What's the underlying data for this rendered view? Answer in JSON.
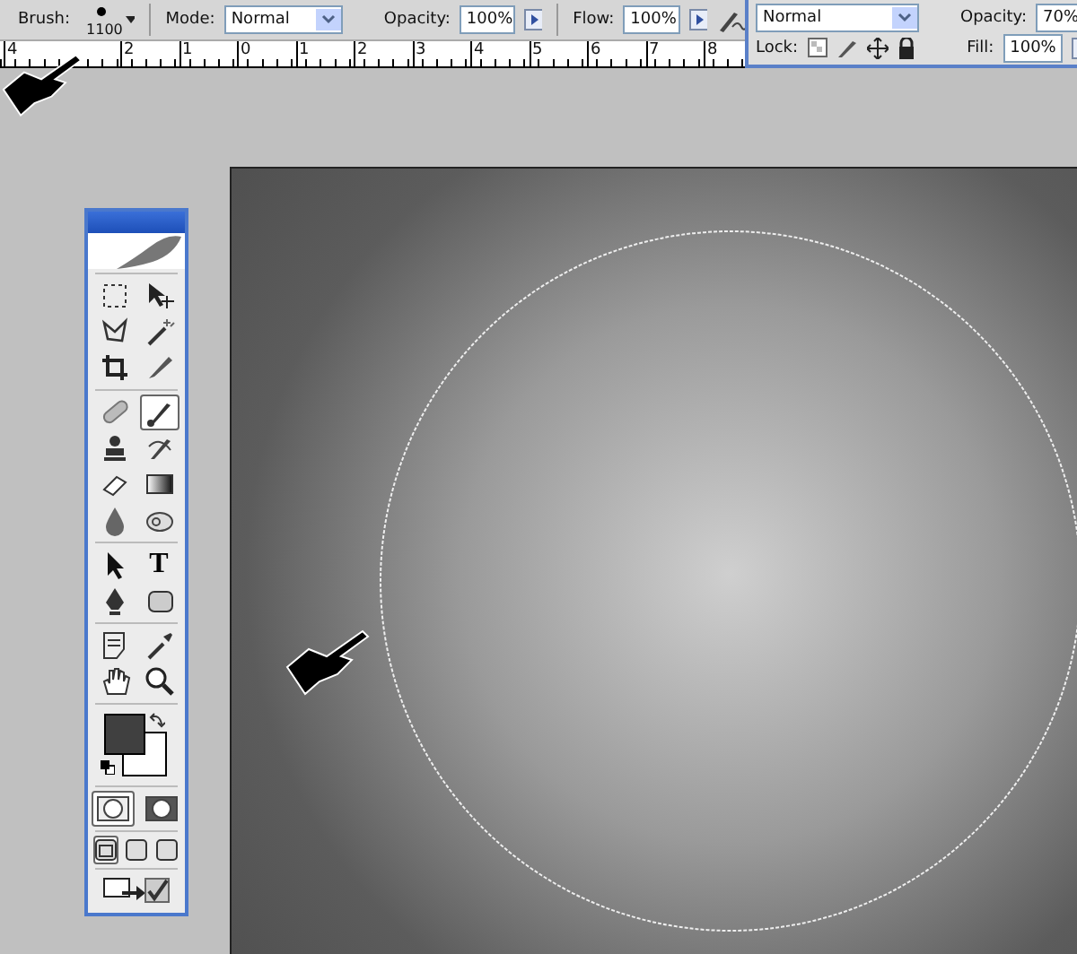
{
  "options_bar": {
    "brush_label": "Brush:",
    "brush_size": "1100",
    "mode_label": "Mode:",
    "mode_value": "Normal",
    "opacity_label": "Opacity:",
    "opacity_value": "100%",
    "flow_label": "Flow:",
    "flow_value": "100%"
  },
  "layers_panel": {
    "blend_mode": "Normal",
    "opacity_label": "Opacity:",
    "opacity_value": "70%",
    "lock_label": "Lock:",
    "fill_label": "Fill:",
    "fill_value": "100%"
  },
  "ruler": {
    "ticks": [
      "4",
      "2",
      "1",
      "0",
      "1",
      "2",
      "3",
      "4",
      "5",
      "6",
      "7",
      "8"
    ]
  },
  "toolbox": {
    "groups": [
      [
        {
          "kind": "marquee",
          "selected": false
        },
        {
          "kind": "move",
          "selected": false
        },
        {
          "kind": "lasso",
          "selected": false
        },
        {
          "kind": "magic-wand",
          "selected": false
        },
        {
          "kind": "crop",
          "selected": false
        },
        {
          "kind": "slice",
          "selected": false
        }
      ],
      [
        {
          "kind": "bandage",
          "selected": false
        },
        {
          "kind": "brush",
          "selected": true
        },
        {
          "kind": "stamp",
          "selected": false
        },
        {
          "kind": "history-brush",
          "selected": false
        },
        {
          "kind": "eraser",
          "selected": false
        },
        {
          "kind": "gradient",
          "selected": false
        },
        {
          "kind": "drop",
          "selected": false
        },
        {
          "kind": "dodge",
          "selected": false
        }
      ],
      [
        {
          "kind": "arrow",
          "selected": false
        },
        {
          "kind": "type",
          "selected": false,
          "glyph": "T"
        },
        {
          "kind": "pen",
          "selected": false
        },
        {
          "kind": "shape",
          "selected": false
        }
      ],
      [
        {
          "kind": "note",
          "selected": false
        },
        {
          "kind": "eyedropper",
          "selected": false
        },
        {
          "kind": "hand",
          "selected": false
        },
        {
          "kind": "zoom",
          "selected": false
        }
      ]
    ],
    "mask_modes": [
      {
        "selected": true
      },
      {
        "selected": false
      }
    ],
    "screen_modes": [
      {
        "selected": true
      },
      {
        "selected": false
      },
      {
        "selected": false
      }
    ]
  }
}
